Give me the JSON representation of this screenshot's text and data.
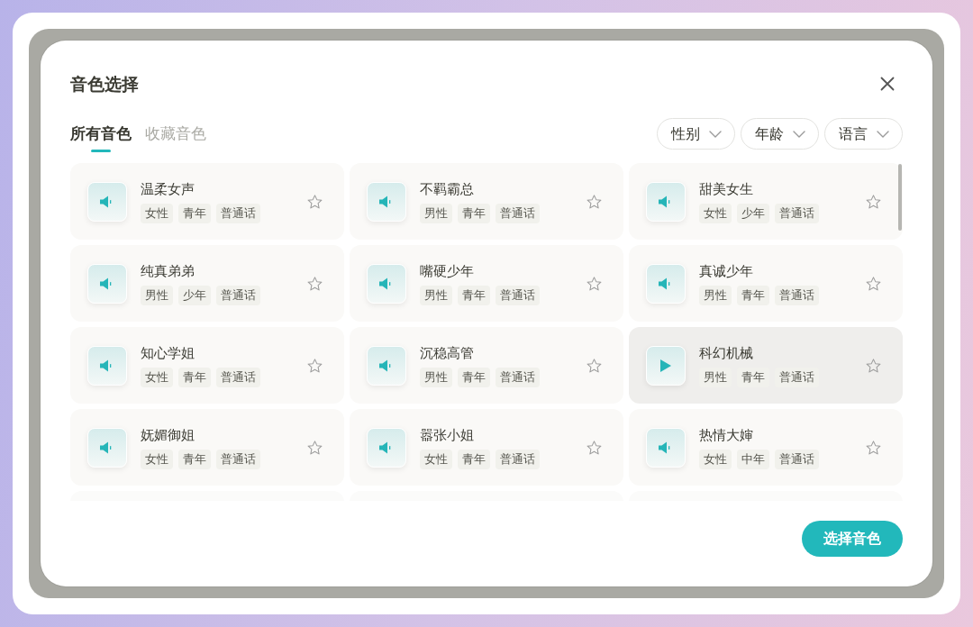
{
  "dialog": {
    "title": "音色选择"
  },
  "tabs": [
    {
      "label": "所有音色",
      "selected": true
    },
    {
      "label": "收藏音色",
      "selected": false
    }
  ],
  "filters": [
    {
      "label": "性别"
    },
    {
      "label": "年龄"
    },
    {
      "label": "语言"
    }
  ],
  "voices": [
    {
      "name": "温柔女声",
      "tags": [
        "女性",
        "青年",
        "普通话"
      ],
      "selected": false,
      "favorite": false
    },
    {
      "name": "不羁霸总",
      "tags": [
        "男性",
        "青年",
        "普通话"
      ],
      "selected": false,
      "favorite": false
    },
    {
      "name": "甜美女生",
      "tags": [
        "女性",
        "少年",
        "普通话"
      ],
      "selected": false,
      "favorite": false
    },
    {
      "name": "纯真弟弟",
      "tags": [
        "男性",
        "少年",
        "普通话"
      ],
      "selected": false,
      "favorite": false
    },
    {
      "name": "嘴硬少年",
      "tags": [
        "男性",
        "青年",
        "普通话"
      ],
      "selected": false,
      "favorite": false
    },
    {
      "name": "真诚少年",
      "tags": [
        "男性",
        "青年",
        "普通话"
      ],
      "selected": false,
      "favorite": false
    },
    {
      "name": "知心学姐",
      "tags": [
        "女性",
        "青年",
        "普通话"
      ],
      "selected": false,
      "favorite": false
    },
    {
      "name": "沉稳高管",
      "tags": [
        "男性",
        "青年",
        "普通话"
      ],
      "selected": false,
      "favorite": false
    },
    {
      "name": "科幻机械",
      "tags": [
        "男性",
        "青年",
        "普通话"
      ],
      "selected": true,
      "favorite": false
    },
    {
      "name": "妩媚御姐",
      "tags": [
        "女性",
        "青年",
        "普通话"
      ],
      "selected": false,
      "favorite": false
    },
    {
      "name": "嚣张小姐",
      "tags": [
        "女性",
        "青年",
        "普通话"
      ],
      "selected": false,
      "favorite": false
    },
    {
      "name": "热情大婶",
      "tags": [
        "女性",
        "中年",
        "普通话"
      ],
      "selected": false,
      "favorite": false
    }
  ],
  "confirm_button": {
    "label": "选择音色"
  }
}
